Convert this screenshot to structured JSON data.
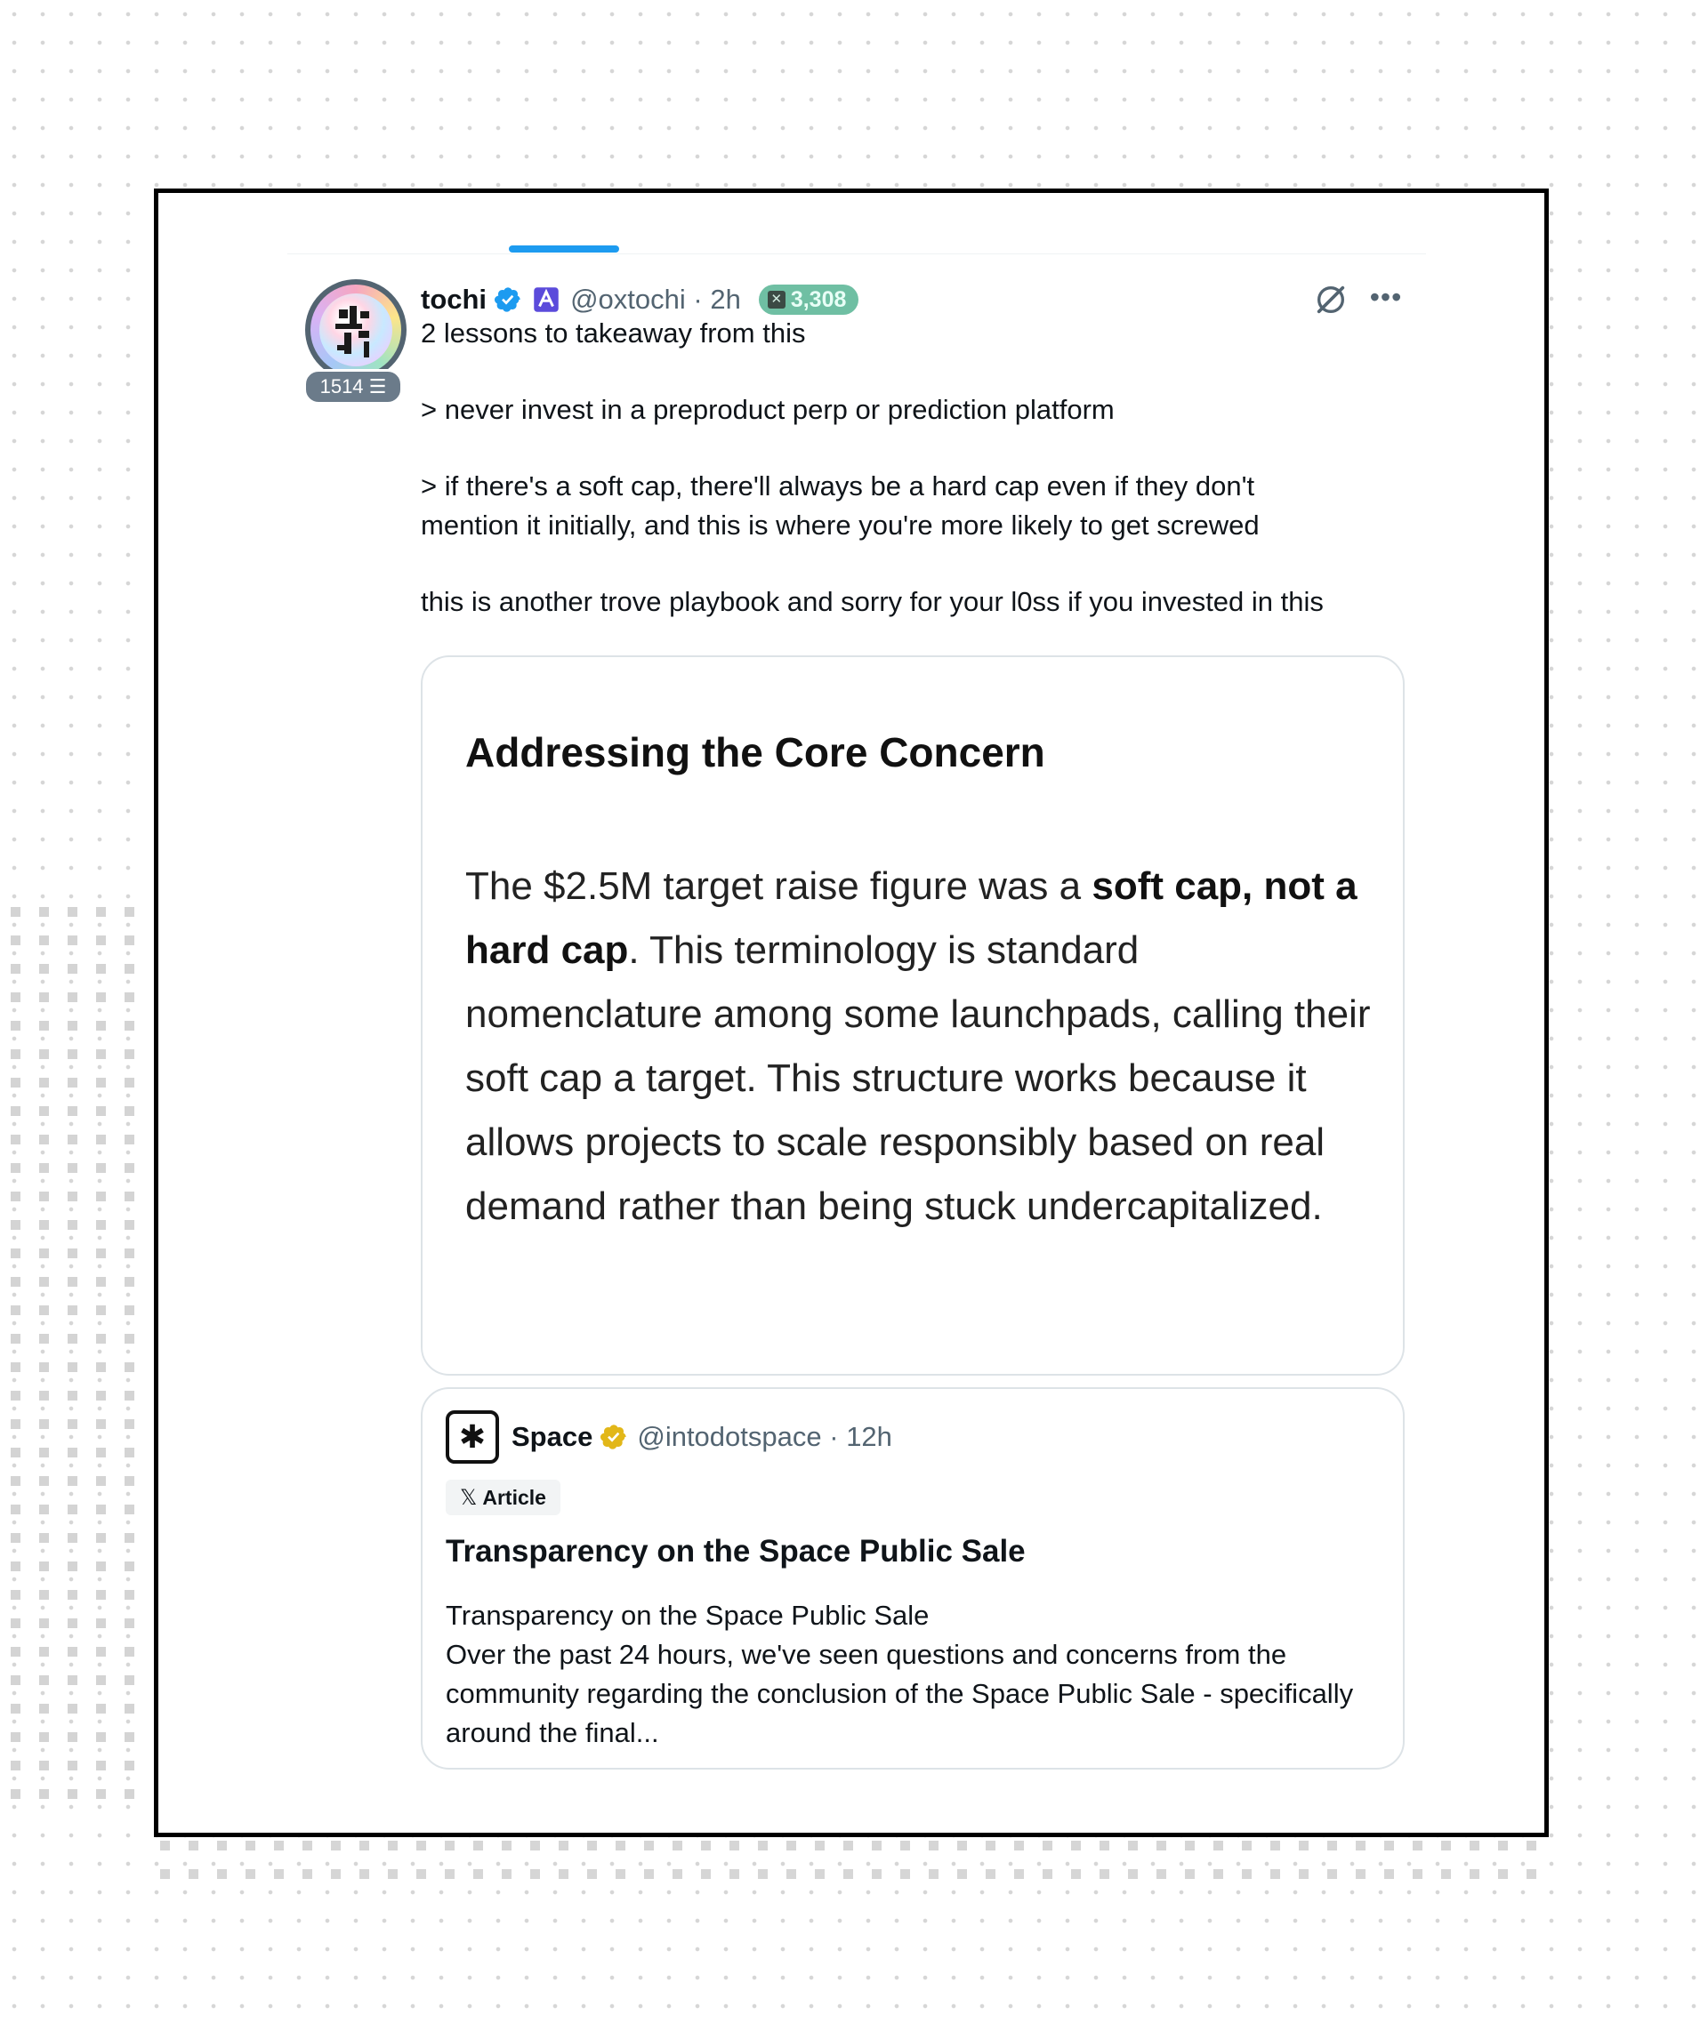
{
  "post": {
    "author_name": "tochi",
    "handle": "@oxtochi",
    "time": "2h",
    "x_score": "3,308",
    "level_badge": "1514",
    "text_line1": "2 lessons to takeaway from this",
    "text_line2": "> never invest in a preproduct perp or prediction platform",
    "text_line3": "> if there's a soft cap, there'll always be a hard cap even if they don't",
    "text_line4": "mention it initially, and this is where you're more likely to get screwed",
    "text_line5": "this is another trove playbook and sorry for your l0ss if you invested in this"
  },
  "image_card": {
    "title": "Addressing the Core Concern",
    "body_part1": "The $2.5M target raise figure was a ",
    "body_bold": "soft cap, not a hard cap",
    "body_part2": ". This terminology is standard nomenclature among some launchpads, calling their soft cap a target. This structure works because it allows projects to scale responsibly based on real demand rather than being stuck undercapitalized."
  },
  "quoted": {
    "avatar_glyph": "✱",
    "name": "Space",
    "handle": "@intodotspace",
    "time": "12h",
    "badge": "Article",
    "title": "Transparency on the Space Public Sale",
    "line1": "Transparency on the Space Public Sale",
    "line2": "Over the past 24 hours, we've seen questions and concerns from the community regarding the conclusion of the Space Public Sale - specifically around the final..."
  },
  "colors": {
    "accent": "#1d9bf0",
    "verified_blue": "#1d9bf0",
    "verified_gold": "#e2b719",
    "secondary_text": "#536471",
    "x_score_bg": "#6fbfa3"
  },
  "icons": [
    "verified-icon",
    "affiliate-icon",
    "grok-icon",
    "more-icon",
    "x-logo-icon"
  ]
}
